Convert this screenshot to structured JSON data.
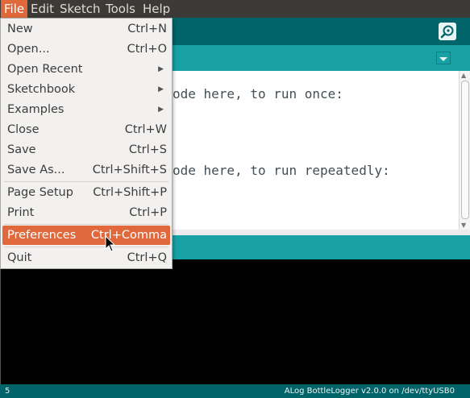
{
  "menubar": {
    "items": [
      {
        "label": "File"
      },
      {
        "label": "Edit"
      },
      {
        "label": "Sketch"
      },
      {
        "label": "Tools"
      },
      {
        "label": "Help"
      }
    ]
  },
  "toolbar": {
    "serial_monitor_icon": "magnifier-icon"
  },
  "editor": {
    "lines": [
      "ode here, to run once:",
      "ode here, to run repeatedly:"
    ]
  },
  "file_menu": {
    "items": [
      {
        "label": "New",
        "accel": "Ctrl+N"
      },
      {
        "label": "Open...",
        "accel": "Ctrl+O"
      },
      {
        "label": "Open Recent",
        "submenu": true
      },
      {
        "label": "Sketchbook",
        "submenu": true
      },
      {
        "label": "Examples",
        "submenu": true
      },
      {
        "label": "Close",
        "accel": "Ctrl+W"
      },
      {
        "label": "Save",
        "accel": "Ctrl+S"
      },
      {
        "label": "Save As...",
        "accel": "Ctrl+Shift+S"
      },
      {
        "label": "Page Setup",
        "accel": "Ctrl+Shift+P"
      },
      {
        "label": "Print",
        "accel": "Ctrl+P"
      },
      {
        "label": "Preferences",
        "accel": "Ctrl+Comma",
        "highlighted": true
      },
      {
        "label": "Quit",
        "accel": "Ctrl+Q"
      }
    ]
  },
  "footer": {
    "line_number": "5",
    "board_port": "ALog BottleLogger v2.0.0 on /dev/ttyUSB0"
  },
  "colors": {
    "accent": "#e0683a",
    "toolbar": "#006468",
    "tabstrip": "#17a1a5"
  }
}
